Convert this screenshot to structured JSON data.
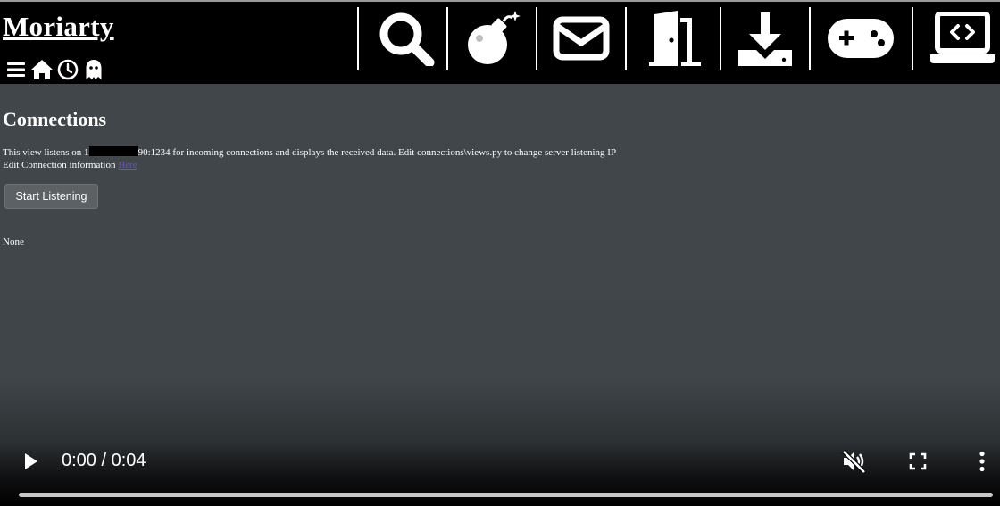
{
  "app": {
    "brand": "Moriarty",
    "mini_nav": [
      {
        "name": "menu-icon"
      },
      {
        "name": "home-icon"
      },
      {
        "name": "history-icon"
      },
      {
        "name": "ghost-icon"
      }
    ],
    "main_nav": [
      {
        "name": "search-icon"
      },
      {
        "name": "bomb-icon"
      },
      {
        "name": "envelope-icon"
      },
      {
        "name": "door-icon"
      },
      {
        "name": "download-icon"
      },
      {
        "name": "gamepad-icon"
      },
      {
        "name": "laptop-code-icon"
      }
    ]
  },
  "page": {
    "title": "Connections",
    "desc_before": "This view listens on 1",
    "desc_after": "90:1234 for incoming connections and displays the received data. Edit connections\\views.py to change server listening IP",
    "edit_text": "Edit Connection information ",
    "edit_link": "Here",
    "button_label": "Start Listening",
    "result_text": "None"
  },
  "video": {
    "time_display": "0:00 / 0:04",
    "progress": 0,
    "muted": true
  },
  "colors": {
    "background": "#40464a",
    "navbar": "#000000",
    "link": "#6d4fc2",
    "button": "#5e6164"
  }
}
